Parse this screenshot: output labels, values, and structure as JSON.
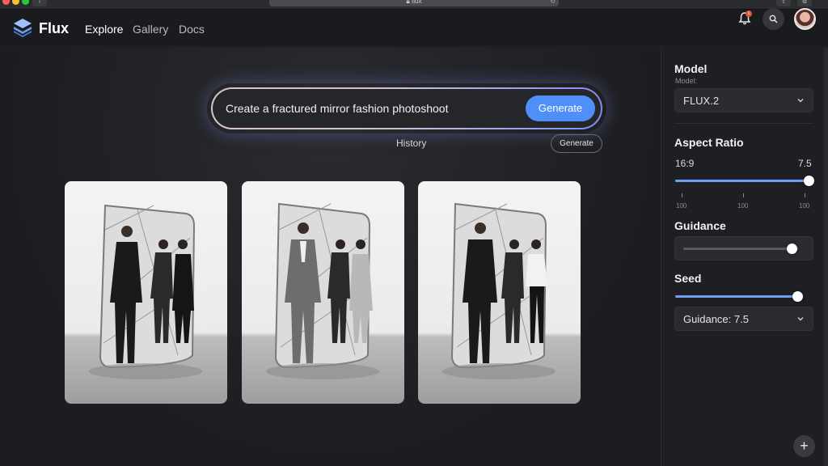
{
  "browser": {
    "url": "flux",
    "icons": [
      "back-icon",
      "refresh-icon",
      "share-icon",
      "tabs-icon"
    ]
  },
  "header": {
    "brand": "Flux",
    "nav": [
      "Explore",
      "Gallery",
      "Docs"
    ],
    "active_nav": "Explore",
    "notification_count": "1"
  },
  "prompt": {
    "text": "Create a fractured mirror fashion photoshoot",
    "generate_label": "Generate"
  },
  "history": {
    "label": "History",
    "generate_label": "Generate"
  },
  "gallery": {
    "images": [
      {
        "alt": "fashion-photoshoot-image-1"
      },
      {
        "alt": "fashion-photoshoot-image-2"
      },
      {
        "alt": "fashion-photoshoot-image-3"
      }
    ]
  },
  "panel": {
    "model": {
      "title": "Model",
      "sublabel": "Model:",
      "value": "FLUX.2"
    },
    "aspect_ratio": {
      "title": "Aspect Ratio",
      "left_value": "16:9",
      "right_value": "7.5",
      "slider_fraction": 1.0,
      "ticks": [
        "100",
        "100",
        "100"
      ]
    },
    "guidance": {
      "title": "Guidance",
      "slider_fraction": 0.95
    },
    "seed": {
      "title": "Seed",
      "slider_fraction": 0.96,
      "select_value": "Guidance: 7.5"
    }
  },
  "colors": {
    "accent": "#4f8ff7",
    "background": "#1c1d20",
    "panel": "#1e1f22"
  }
}
